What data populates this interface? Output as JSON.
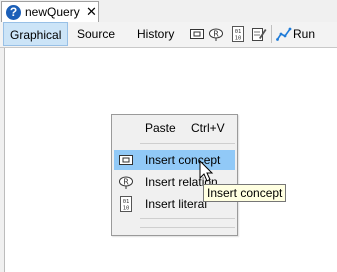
{
  "document_tab": {
    "title": "newQuery",
    "icon": "help-icon",
    "close_icon": "close-icon"
  },
  "toolbar": {
    "tabs": [
      {
        "label": "Graphical",
        "active": true
      },
      {
        "label": "Source",
        "active": false
      },
      {
        "label": "History",
        "active": false
      }
    ],
    "icons": [
      "concept-icon",
      "relation-icon",
      "literal-icon",
      "edit-icon"
    ],
    "run_layout_label": "Run layou",
    "run_layout_icon": "run-layout-icon"
  },
  "context_menu": {
    "items": [
      {
        "label": "Paste",
        "shortcut": "Ctrl+V",
        "icon": ""
      },
      {
        "label": "Insert concept",
        "icon": "concept-icon",
        "highlighted": true
      },
      {
        "label": "Insert relation",
        "icon": "relation-icon"
      },
      {
        "label": "Insert literal",
        "icon": "literal-icon"
      }
    ]
  },
  "tooltip": {
    "text": "Insert concept"
  },
  "colors": {
    "menu_highlight": "#91c9f7",
    "active_tab": "#cce4f7",
    "tooltip_bg": "#ffffe1",
    "help_icon": "#1b5fb8"
  }
}
